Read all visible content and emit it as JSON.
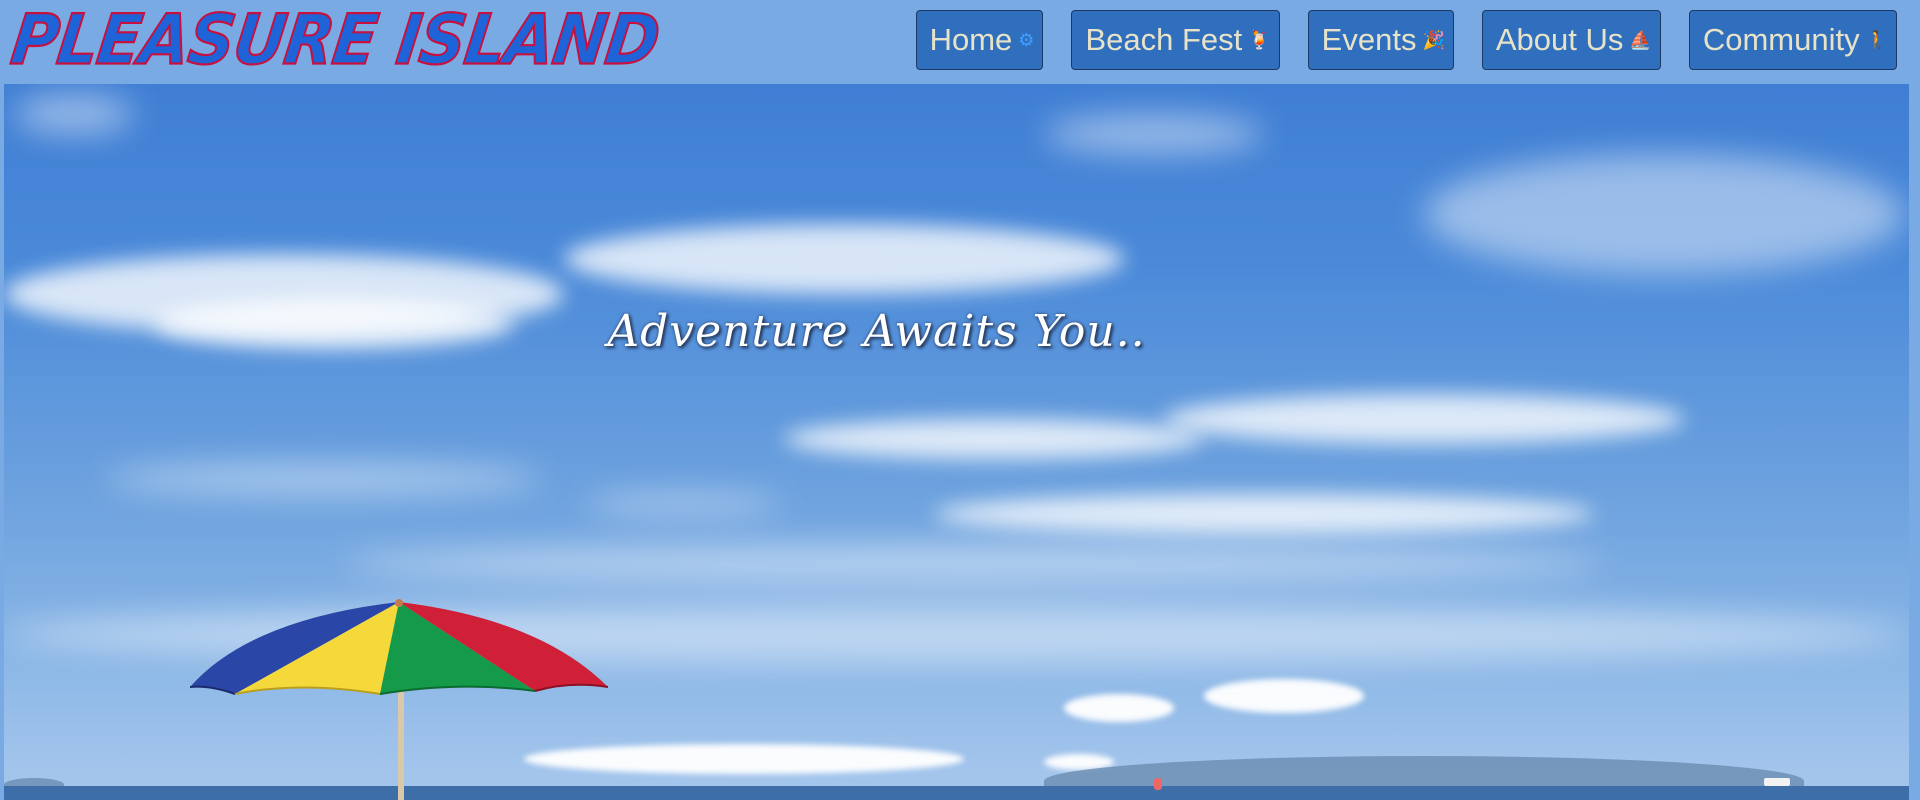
{
  "site": {
    "logo_text": "PLEASURE ISLAND"
  },
  "nav": {
    "items": [
      {
        "label": "Home",
        "icon": "gear-icon"
      },
      {
        "label": "Beach Fest",
        "icon": "cocktail-icon"
      },
      {
        "label": "Events",
        "icon": "party-popper-icon"
      },
      {
        "label": "About Us",
        "icon": "sailboat-icon"
      },
      {
        "label": "Community",
        "icon": "person-icon"
      }
    ]
  },
  "hero": {
    "tagline": "Adventure Awaits You.."
  },
  "colors": {
    "header_bg": "#7aaae3",
    "nav_button_bg": "#2f6fbe",
    "nav_button_text": "#e8e3c8",
    "logo_fill": "#1f63d8",
    "logo_outline": "#c8103e"
  }
}
